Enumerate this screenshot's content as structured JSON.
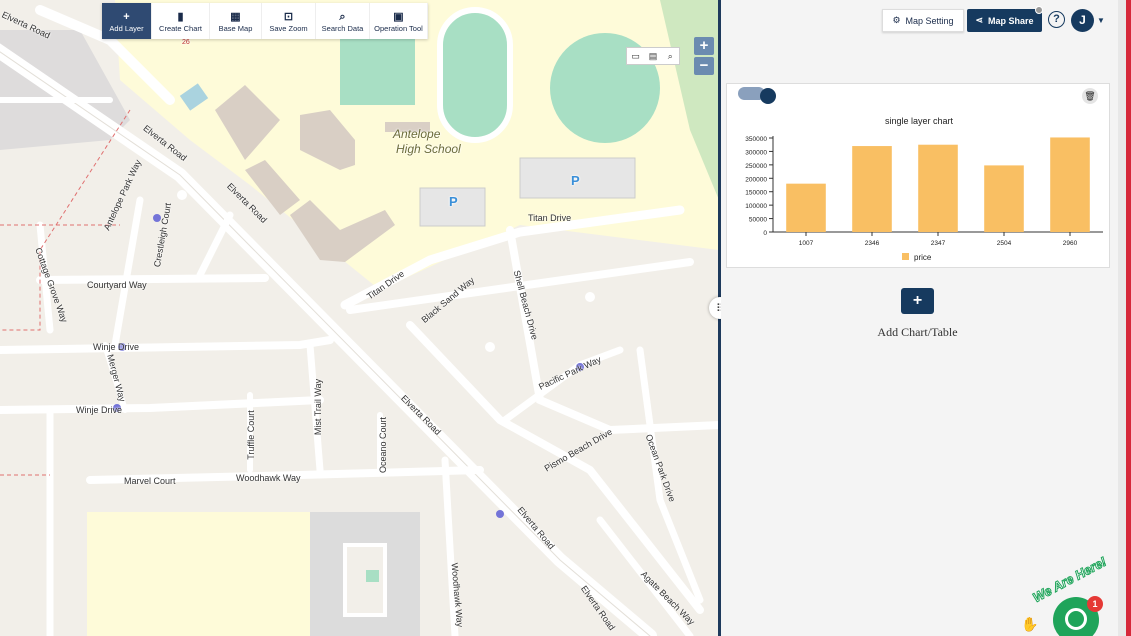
{
  "toolbar": {
    "add_layer": "Add Layer",
    "create_chart": "Create Chart",
    "base_map": "Base Map",
    "save_zoom": "Save Zoom",
    "search_data": "Search Data",
    "operation_tool": "Operation Tool"
  },
  "map": {
    "zoom_in": "+",
    "zoom_out": "−",
    "labels": {
      "school": "Antelope",
      "school2": "High School",
      "elverta": "Elverta Road",
      "titan": "Titan Drive",
      "courtyard": "Courtyard Way",
      "winje": "Winje Drive",
      "black_sand": "Black Sand Way",
      "shell_beach": "Shell Beach Drive",
      "pacific_park": "Pacific Park Way",
      "pismo": "Pismo Beach Drive",
      "ocean_park": "Ocean Park Drive",
      "marvel": "Marvel Court",
      "woodhawk": "Woodhawk Way",
      "truffle": "Truffle Court",
      "mist_trail": "Mist Trail Way",
      "oceano": "Oceano Court",
      "crestleigh": "Crestleigh Court",
      "antelope_park": "Antelope Park Way",
      "cottage_grove": "Cottage Grove Way",
      "merger": "Merger Way",
      "agate": "Agate Beach Way",
      "parking": "P",
      "num": "26"
    }
  },
  "panel": {
    "map_setting": "Map Setting",
    "map_share": "Map Share",
    "help": "?",
    "avatar": "J",
    "add_chart_label": "Add Chart/Table",
    "add_chart_symbol": "+"
  },
  "chat": {
    "badge": "We Are Here!",
    "count": "1"
  },
  "colors": {
    "navy": "#163a5f",
    "bar": "#f9bf63",
    "accent_red": "#d6283a",
    "chat_green": "#1fa45a"
  },
  "chart_data": {
    "type": "bar",
    "title": "single layer chart",
    "categories": [
      "1007",
      "2346",
      "2347",
      "2504",
      "2960"
    ],
    "series": [
      {
        "name": "price",
        "values": [
          180000,
          320000,
          325000,
          248000,
          352000
        ]
      }
    ],
    "ylim": [
      0,
      350000
    ],
    "yticks": [
      0,
      50000,
      100000,
      150000,
      200000,
      250000,
      300000,
      350000
    ],
    "legend": "bottom"
  }
}
